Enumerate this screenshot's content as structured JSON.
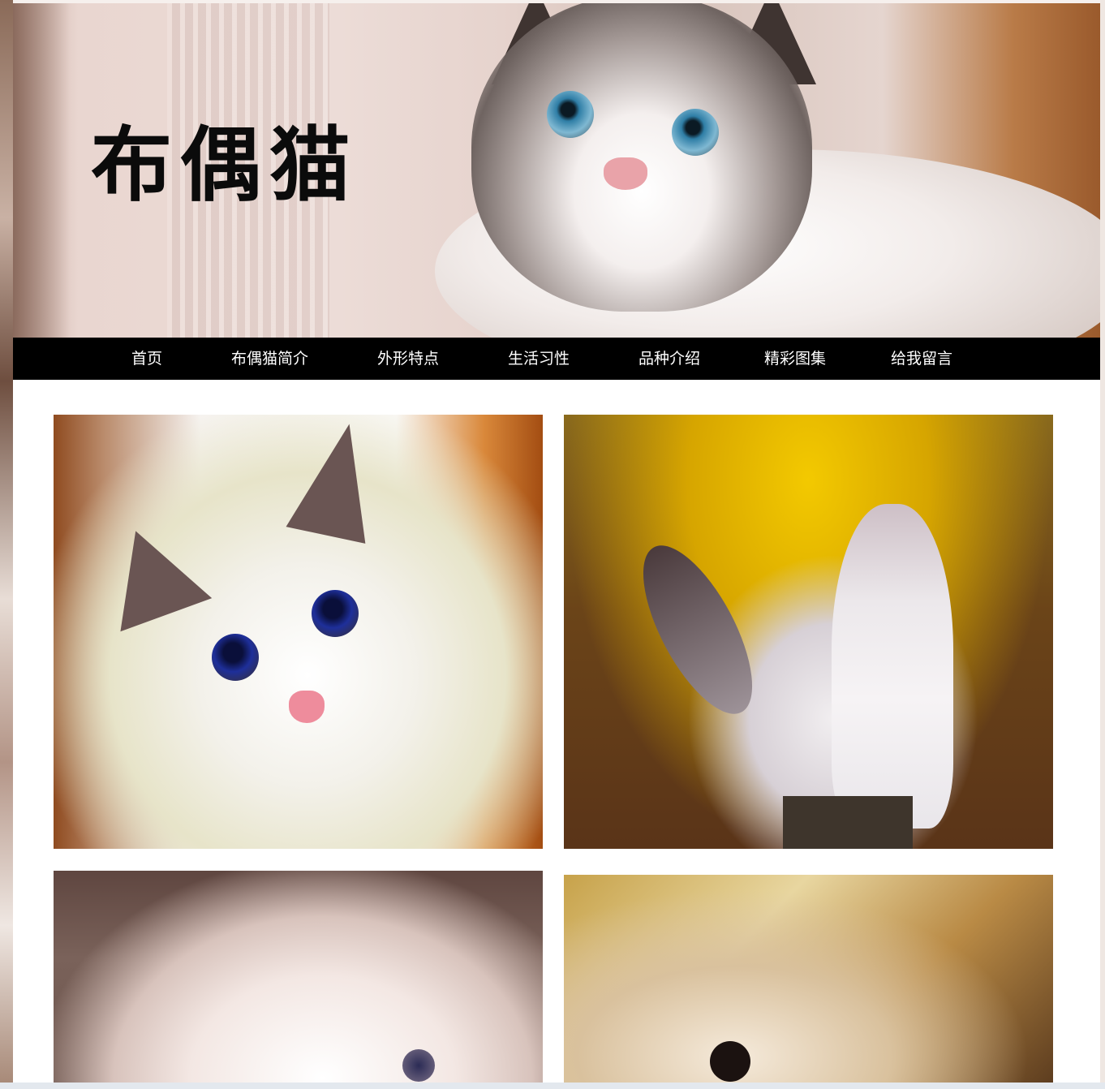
{
  "header": {
    "title": "布偶猫"
  },
  "nav": {
    "items": [
      {
        "label": "首页"
      },
      {
        "label": "布偶猫简介"
      },
      {
        "label": "外形特点"
      },
      {
        "label": "生活习性"
      },
      {
        "label": "品种介绍"
      },
      {
        "label": "精彩图集"
      },
      {
        "label": "给我留言"
      }
    ]
  },
  "colors": {
    "nav_background": "#000000",
    "nav_text": "#ffffff",
    "title_text": "#0b0b0b",
    "page_background": "#ffffff"
  }
}
